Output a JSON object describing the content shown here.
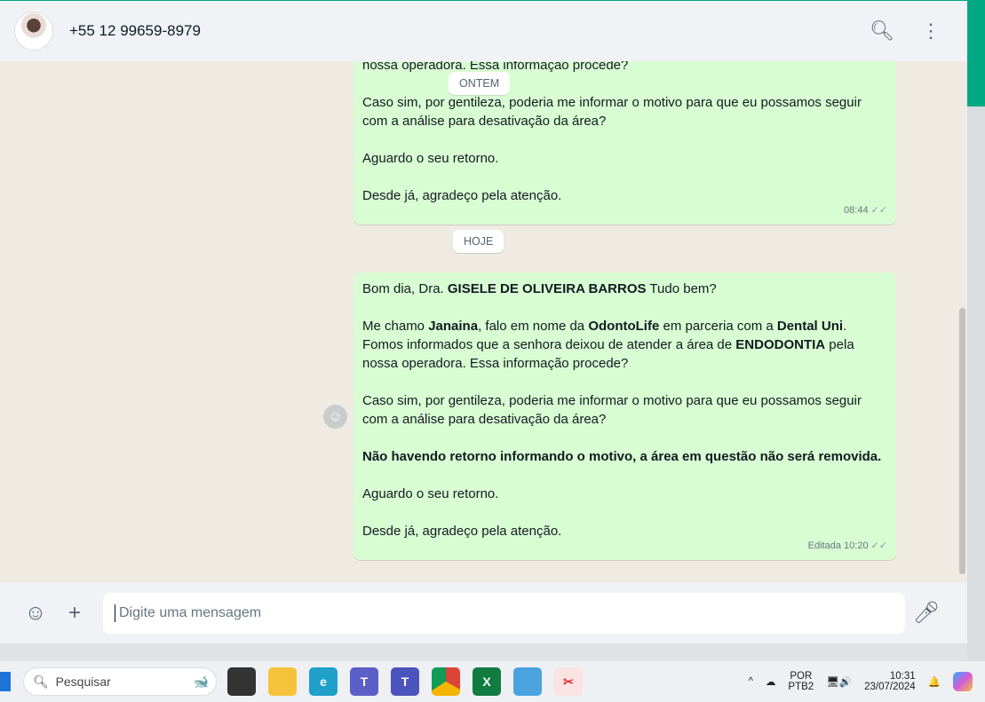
{
  "header": {
    "contact": "+55 12 99659-8979"
  },
  "dates": {
    "yesterday": "ONTEM",
    "today": "HOJE"
  },
  "msg1": {
    "lines": [
      "nossa operadora. Essa informação procede?",
      "Caso sim, por gentileza, poderia me informar o motivo para que eu possamos seguir com a análise para desativação da área?",
      "Aguardo o seu retorno.",
      "Desde já, agradeço pela atenção."
    ],
    "time": "08:44"
  },
  "msg2": {
    "greet": "Bom dia, Dra.",
    "name": "GISELE DE OLIVEIRA BARROS",
    "greet2": "Tudo bem?",
    "p2a": "Me chamo",
    "sender": "Janaina",
    "p2b": ", falo em nome da",
    "company": "OdontoLife",
    "p2c": "em parceria com a",
    "partner": "Dental Uni",
    "p2d": ". Fomos informados que a senhora deixou de atender a área de",
    "area": "ENDODONTIA",
    "p2e": "pela nossa operadora. Essa informação procede?",
    "p3": "Caso sim, por gentileza, poderia me informar o motivo para que eu possamos seguir com a análise para desativação da área?",
    "p4": "Não havendo retorno informando o motivo, a área em questão não será removida.",
    "p5": "Aguardo o seu retorno.",
    "p6": "Desde já, agradeço pela atenção.",
    "edited": "Editada",
    "time": "10:20"
  },
  "composer": {
    "placeholder": "Digite uma mensagem"
  },
  "taskbar": {
    "search": "Pesquisar",
    "lang1": "POR",
    "lang2": "PTB2",
    "time": "10:31",
    "date": "23/07/2024"
  }
}
